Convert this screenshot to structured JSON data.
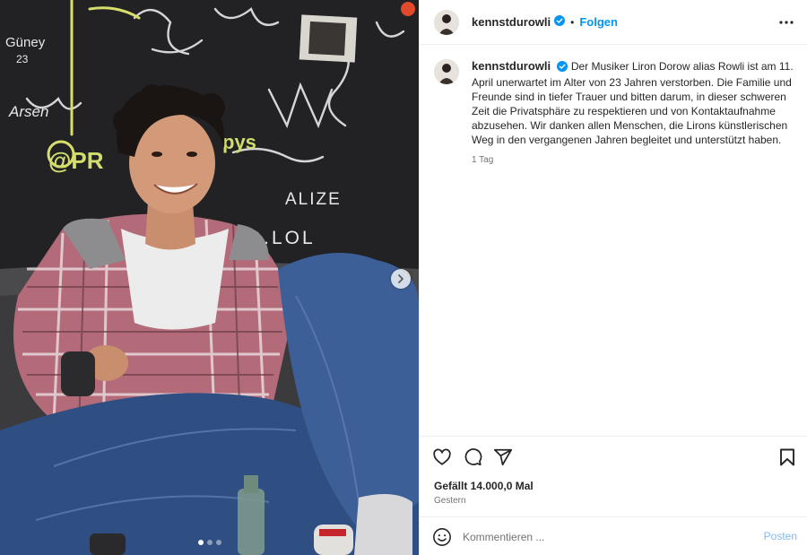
{
  "post": {
    "username": "kennstdurowli",
    "verified": true,
    "follow_label": "Folgen",
    "separator": "•",
    "caption": "Der Musiker Liron Dorow alias Rowli ist am 11. April unerwartet im Alter von 23 Jahren verstorben. Die Familie und Freunde sind in tiefer Trauer und bitten darum, in dieser schweren Zeit die Privatsphäre zu respektieren und von Kontaktaufnahme abzusehen. Wir danken allen Menschen, die Lirons künstlerischen Weg in den vergangenen Jahren begleitet und unterstützt haben.",
    "caption_age": "1 Tag",
    "likes": "Gefällt 14.000,0 Mal",
    "date": "Gestern"
  },
  "comment_box": {
    "placeholder": "Kommentieren ...",
    "post_label": "Posten"
  },
  "carousel": {
    "slide_count": 3,
    "active_index": 0
  },
  "graffiti": {
    "g1": "Güney",
    "g2": "23",
    "g3": "@PR",
    "g4": "ALIZE",
    "g5": "D.LOL",
    "g6": "Arsen",
    "g7": "pys"
  },
  "icons": {
    "verified": "verified-badge-icon",
    "more": "more-options-icon",
    "like": "heart-icon",
    "comment": "comment-icon",
    "share": "share-icon",
    "save": "bookmark-icon",
    "emoji": "emoji-icon",
    "next": "chevron-right-icon"
  },
  "colors": {
    "accent": "#0095f6",
    "verified": "#0095f6",
    "post_disabled": "#7dbbf3",
    "muted": "#737373",
    "text": "#262626"
  }
}
